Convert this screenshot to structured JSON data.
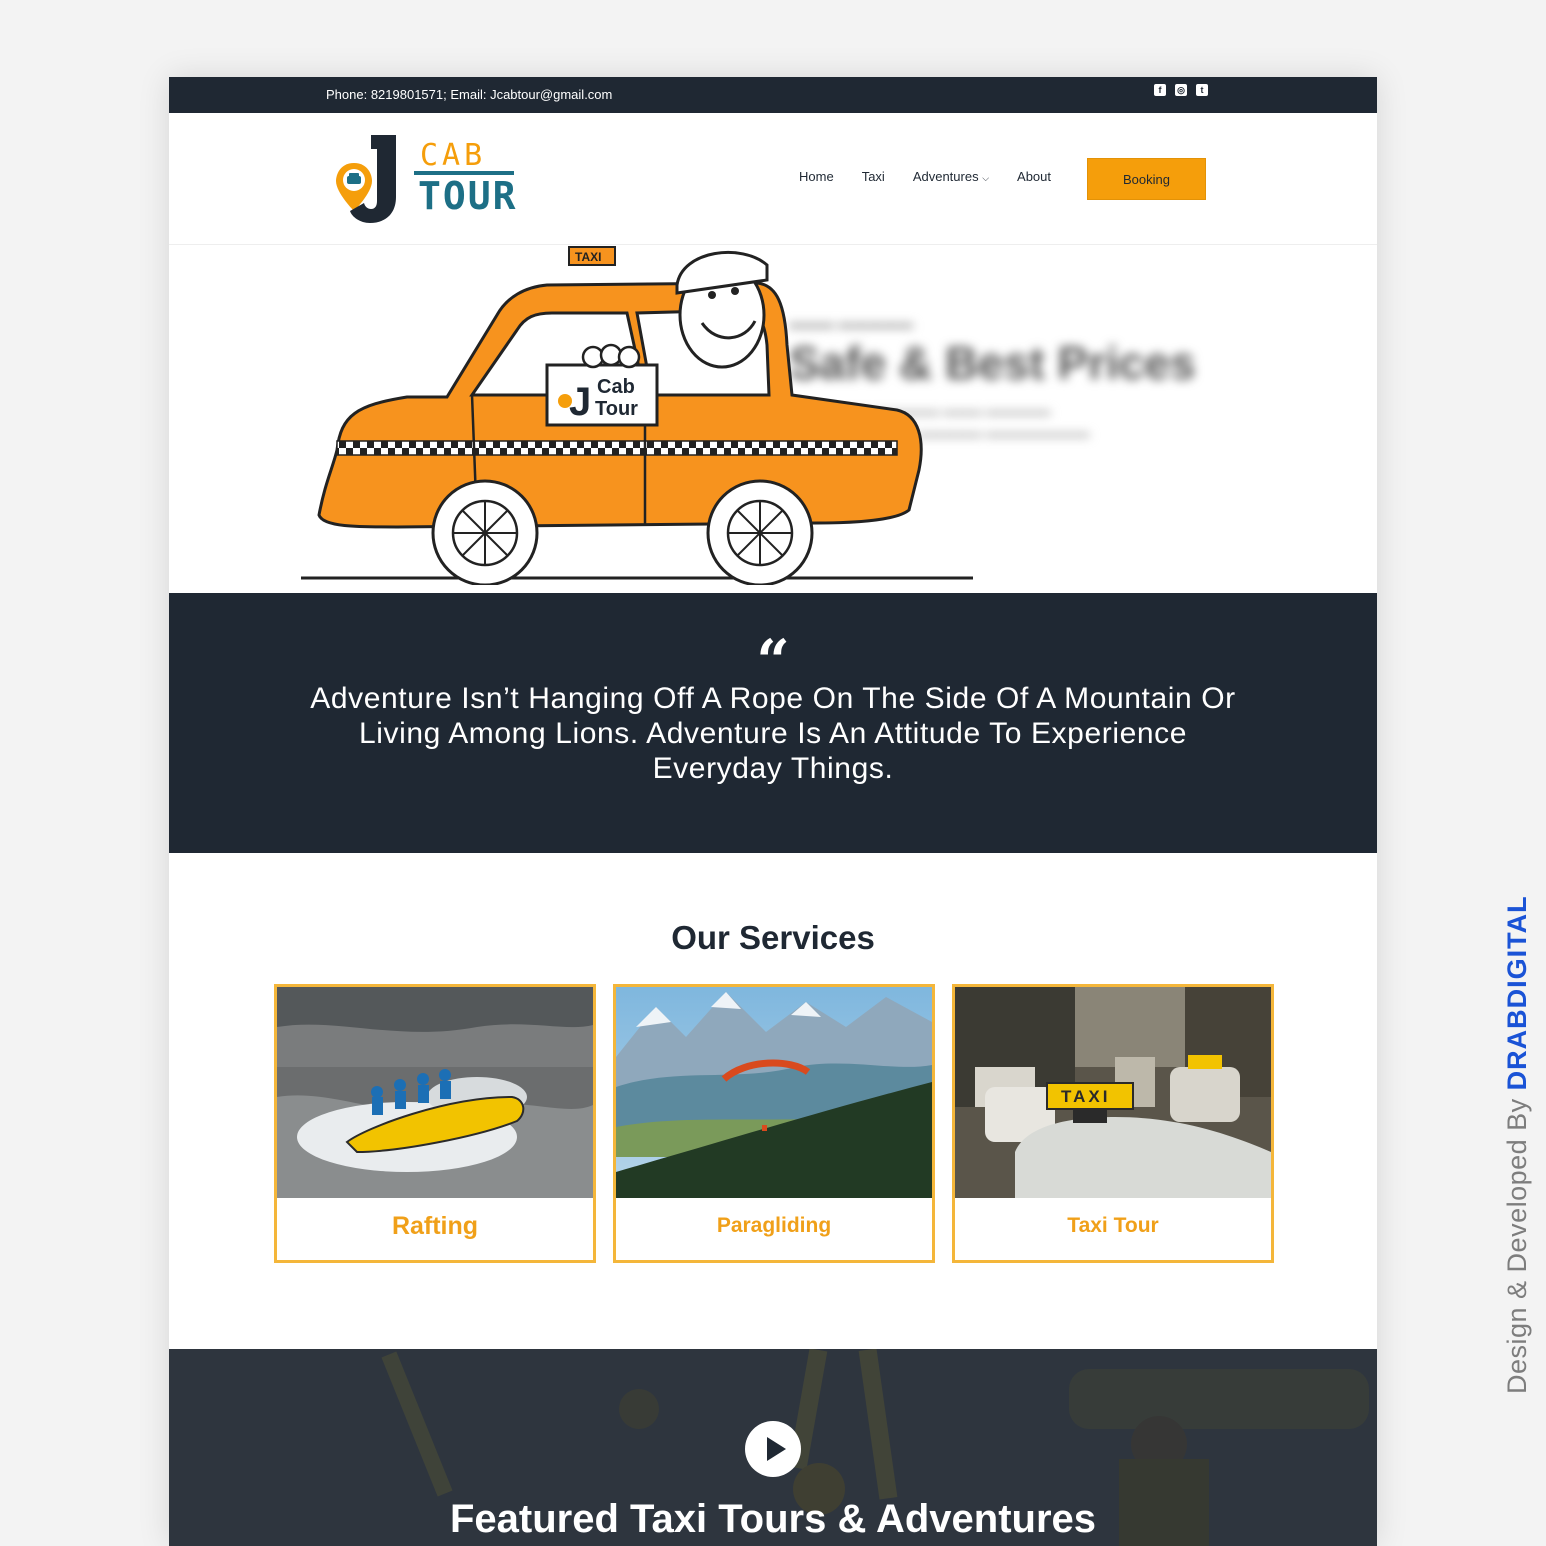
{
  "topbar": {
    "contact": "Phone: 8219801571; Email: Jcabtour@gmail.com",
    "social_icons": [
      "facebook-icon",
      "instagram-icon",
      "twitter-icon"
    ]
  },
  "header": {
    "logo": {
      "letter": "J",
      "line1": "CAB",
      "line2": "TOUR"
    },
    "nav": {
      "home": "Home",
      "taxi": "Taxi",
      "adventures": "Adventures",
      "about": "About"
    },
    "booking_label": "Booking"
  },
  "hero": {
    "roof_sign": "TAXI",
    "sign_line1": "Cab",
    "sign_line2": "Tour",
    "blurred_heading": "Safe & Best Prices"
  },
  "quote": {
    "mark": "“",
    "text": "Adventure Isn’t Hanging Off A Rope On The Side Of A Mountain Or Living Among Lions. Adventure Is An Attitude To Experience Everyday Things."
  },
  "services": {
    "title": "Our Services",
    "cards": [
      {
        "label": "Rafting"
      },
      {
        "label": "Paragliding"
      },
      {
        "label": "Taxi Tour"
      }
    ]
  },
  "featured": {
    "title": "Featured Taxi Tours & Adventures"
  },
  "credit": {
    "prefix": "Design & Developed By ",
    "brand": "DRABDIGITAL"
  },
  "colors": {
    "dark": "#1f2833",
    "accent": "#f59e0b",
    "card_border": "#f4b63a",
    "teal": "#1d6f86"
  }
}
